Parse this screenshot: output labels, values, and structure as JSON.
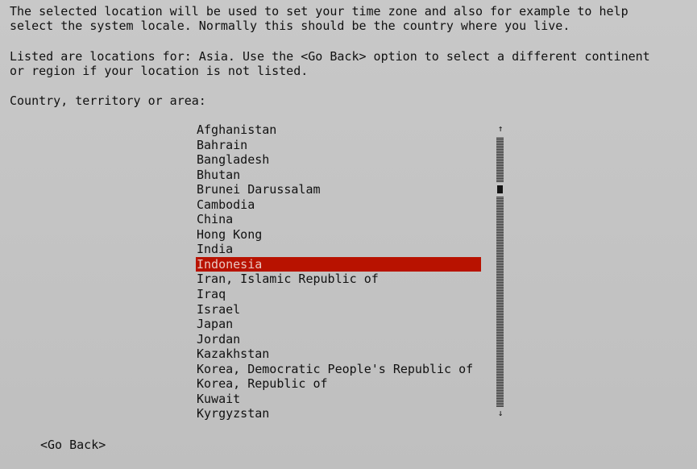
{
  "intro": {
    "line1": "The selected location will be used to set your time zone and also for example to help",
    "line2": "select the system locale. Normally this should be the country where you live.",
    "line3": "Listed are locations for: Asia. Use the <Go Back> option to select a different continent",
    "line4": "or region if your location is not listed."
  },
  "prompt_label": "Country, territory or area:",
  "countries": [
    "Afghanistan",
    "Bahrain",
    "Bangladesh",
    "Bhutan",
    "Brunei Darussalam",
    "Cambodia",
    "China",
    "Hong Kong",
    "India",
    "Indonesia",
    "Iran, Islamic Republic of",
    "Iraq",
    "Israel",
    "Japan",
    "Jordan",
    "Kazakhstan",
    "Korea, Democratic People's Republic of",
    "Korea, Republic of",
    "Kuwait",
    "Kyrgyzstan"
  ],
  "selected_country": "Indonesia",
  "scrollbar": {
    "up_arrow": "↑",
    "down_arrow": "↓"
  },
  "go_back_label": "<Go Back>",
  "colors": {
    "background": "#c4c4c4",
    "text": "#111111",
    "selection": "#b81200",
    "selection_text": "#e9c8c2"
  }
}
